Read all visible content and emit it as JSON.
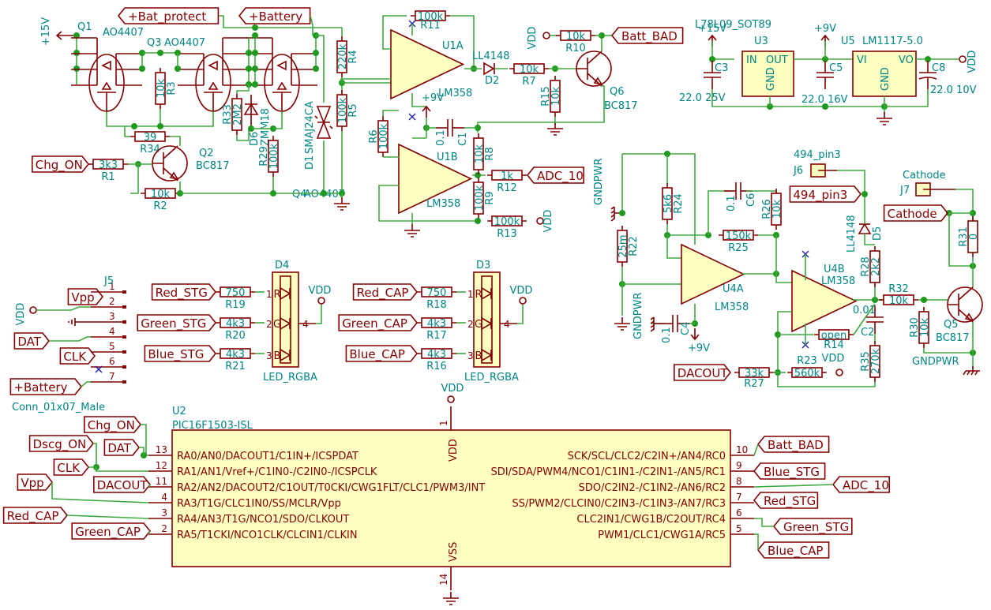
{
  "sheet": {
    "colors": {
      "wire": "#3fa83f",
      "component": "#840000",
      "text": "#008484",
      "body_fill": "#ffffc2",
      "no_connect": "#2020a0"
    }
  },
  "net_labels": {
    "bat_protect": "+Bat_protect",
    "battery": "+Battery",
    "chg_on": "Chg_ON",
    "batt_bad": "Batt_BAD",
    "adc_10": "ADC_10",
    "pin3_494": "494_pin3",
    "cathode": "Cathode",
    "dacout": "DACOUT",
    "j5_vpp": "Vpp",
    "j5_dat": "DAT",
    "j5_clk": "CLK",
    "j5_battery": "+Battery",
    "red_stg": "Red_STG",
    "green_stg": "Green_STG",
    "blue_stg": "Blue_STG",
    "red_cap": "Red_CAP",
    "green_cap": "Green_CAP",
    "blue_cap": "Blue_CAP",
    "u2_chg_on": "Chg_ON",
    "u2_dscg_on": "Dscg_ON",
    "u2_dat": "DAT",
    "u2_clk": "CLK",
    "u2_dacout": "DACOUT",
    "u2_vpp": "Vpp",
    "u2_red_cap": "Red_CAP",
    "u2_green_cap": "Green_CAP",
    "u2_batt_bad": "Batt_BAD",
    "u2_blue_stg": "Blue_STG",
    "u2_adc_10": "ADC_10",
    "u2_red_stg": "Red_STG",
    "u2_green_stg": "Green_STG",
    "u2_blue_cap": "Blue_CAP"
  },
  "power": {
    "v15_q1": "+15V",
    "v15_u3": "+15V",
    "v9_u1": "+9V",
    "v9_u3": "+9V",
    "v9_u4": "+9V",
    "vdd_r10": "VDD",
    "vdd_r13": "VDD",
    "vdd_u5": "VDD",
    "vdd_j5": "VDD",
    "vdd_d4": "VDD",
    "vdd_d3": "VDD",
    "vdd_u2": "VDD",
    "vdd_r23": "VDD",
    "gndpwr_r22": "GNDPWR",
    "gndpwr_c4": "GNDPWR",
    "gndpwr_q5": "GNDPWR"
  },
  "components": {
    "Q1": {
      "ref": "Q1",
      "value": "AO4407"
    },
    "Q3": {
      "ref": "Q3",
      "value": "AO4407"
    },
    "Q4": {
      "ref": "Q4",
      "value": "AO4407"
    },
    "Q2": {
      "ref": "Q2",
      "value": "BC817"
    },
    "Q6": {
      "ref": "Q6",
      "value": "BC817"
    },
    "Q5": {
      "ref": "Q5",
      "value": "BC817"
    },
    "R1": {
      "ref": "R1",
      "value": "3k3"
    },
    "R2": {
      "ref": "R2",
      "value": "10k"
    },
    "R3": {
      "ref": "R3",
      "value": "10k"
    },
    "R4": {
      "ref": "R4",
      "value": "220k"
    },
    "R5": {
      "ref": "R5",
      "value": "100k"
    },
    "R33": {
      "ref": "R33",
      "value": "2M2"
    },
    "R29": {
      "ref": "R29",
      "value": "100k"
    },
    "R34": {
      "ref": "R34",
      "value": "39"
    },
    "D6": {
      "ref": "D6",
      "value": "ZMM18"
    },
    "D1": {
      "ref": "D1",
      "value": "SMAJ24CA"
    },
    "U1A": {
      "ref": "U1A",
      "value": "LM358"
    },
    "U1B": {
      "ref": "U1B",
      "value": "LM358"
    },
    "R11": {
      "ref": "R11",
      "value": "100k"
    },
    "D2": {
      "ref": "D2",
      "value": "LL4148"
    },
    "R7": {
      "ref": "R7",
      "value": "10k"
    },
    "R10": {
      "ref": "R10",
      "value": "10k"
    },
    "R15": {
      "ref": "R15",
      "value": "10k"
    },
    "R6": {
      "ref": "R6",
      "value": "100k"
    },
    "C1": {
      "ref": "C1",
      "value": "0.1"
    },
    "R8": {
      "ref": "R8",
      "value": "10k"
    },
    "R9": {
      "ref": "R9",
      "value": "100k"
    },
    "R12": {
      "ref": "R12",
      "value": "1k"
    },
    "R13": {
      "ref": "R13",
      "value": "100k"
    },
    "U3": {
      "ref": "U3",
      "value": "L78L09_SOT89"
    },
    "U5": {
      "ref": "U5",
      "value": "LM1117-5.0"
    },
    "C3": {
      "ref": "C3",
      "value": "22.0 25V"
    },
    "C5": {
      "ref": "C5",
      "value": "22.0 16V"
    },
    "C8": {
      "ref": "C8",
      "value": "22.0 10V"
    },
    "R22": {
      "ref": "R22",
      "value": "25m"
    },
    "R24": {
      "ref": "R24",
      "value": "5k6"
    },
    "R25": {
      "ref": "R25",
      "value": "150k"
    },
    "C6": {
      "ref": "C6",
      "value": "0.1"
    },
    "R26": {
      "ref": "R26",
      "value": "10k"
    },
    "U4A": {
      "ref": "U4A",
      "value": "LM358"
    },
    "U4B": {
      "ref": "U4B",
      "value": "LM358"
    },
    "C4": {
      "ref": "C4",
      "value": "0.1"
    },
    "J6": {
      "ref": "J6",
      "value": "494_pin3"
    },
    "J7": {
      "ref": "J7",
      "value": "Cathode"
    },
    "D5": {
      "ref": "D5",
      "value": "LL4148"
    },
    "R28": {
      "ref": "R28",
      "value": "2k2"
    },
    "R31": {
      "ref": "R31",
      "value": "0"
    },
    "R32": {
      "ref": "R32",
      "value": "10k"
    },
    "R30": {
      "ref": "R30",
      "value": "10k"
    },
    "R14": {
      "ref": "R14",
      "value": "open"
    },
    "C2": {
      "ref": "C2",
      "value": "0.01"
    },
    "R35": {
      "ref": "R35",
      "value": "270k"
    },
    "R27": {
      "ref": "R27",
      "value": "33k"
    },
    "R23": {
      "ref": "R23",
      "value": "560k"
    },
    "J5": {
      "ref": "J5",
      "value": "Conn_01x07_Male"
    },
    "D4": {
      "ref": "D4",
      "value": "LED_RGBA"
    },
    "D3": {
      "ref": "D3",
      "value": "LED_RGBA"
    },
    "R19": {
      "ref": "R19",
      "value": "750"
    },
    "R20": {
      "ref": "R20",
      "value": "4k3"
    },
    "R21": {
      "ref": "R21",
      "value": "4k3"
    },
    "R18": {
      "ref": "R18",
      "value": "750"
    },
    "R17": {
      "ref": "R17",
      "value": "4k3"
    },
    "R16": {
      "ref": "R16",
      "value": "4k3"
    },
    "U2": {
      "ref": "U2",
      "value": "PIC16F1503-ISL"
    }
  },
  "regulator_pins": {
    "in": "IN",
    "out": "OUT",
    "gnd": "GND",
    "vi": "VI",
    "vo": "VO",
    "gnd5": "GND"
  },
  "led_pins": [
    "R",
    "G",
    "B"
  ],
  "u2": {
    "left_pins": [
      {
        "num": "13",
        "name": "RA0/AN0/DACOUT1/C1IN+/ICSPDAT"
      },
      {
        "num": "12",
        "name": "RA1/AN1/Vref+/C1IN0-/C2IN0-/ICSPCLK"
      },
      {
        "num": "11",
        "name": "RA2/AN2/DACOUT2/C1OUT/T0CKI/CWG1FLT/CLC1/PWM3/INT"
      },
      {
        "num": "4",
        "name": "RA3/T1G/CLC1IN0/SS/MCLR/Vpp"
      },
      {
        "num": "3",
        "name": "RA4/AN3/T1G/NCO1/SDO/CLKOUT"
      },
      {
        "num": "2",
        "name": "RA5/T1CKI/NCO1CLK/CLCIN1/CLKIN"
      }
    ],
    "right_pins": [
      {
        "num": "10",
        "name": "SCK/SCL/CLC2/C2IN+/AN4/RC0"
      },
      {
        "num": "9",
        "name": "SDI/SDA/PWM4/NCO1/C1IN1-/C2IN1-/AN5/RC1"
      },
      {
        "num": "8",
        "name": "SDO/C2IN2-/C1IN2-/AN6/RC2"
      },
      {
        "num": "7",
        "name": "SS/PWM2/CLCIN0/C2IN3-/C1IN3-/AN7/RC3"
      },
      {
        "num": "6",
        "name": "CLC2IN1/CWG1B/C2OUT/RC4"
      },
      {
        "num": "5",
        "name": "PWM1/CLC1/CWG1A/RC5"
      }
    ],
    "vdd_pin": {
      "num": "1",
      "name": "VDD"
    },
    "vss_pin": {
      "num": "14",
      "name": "VSS"
    }
  }
}
